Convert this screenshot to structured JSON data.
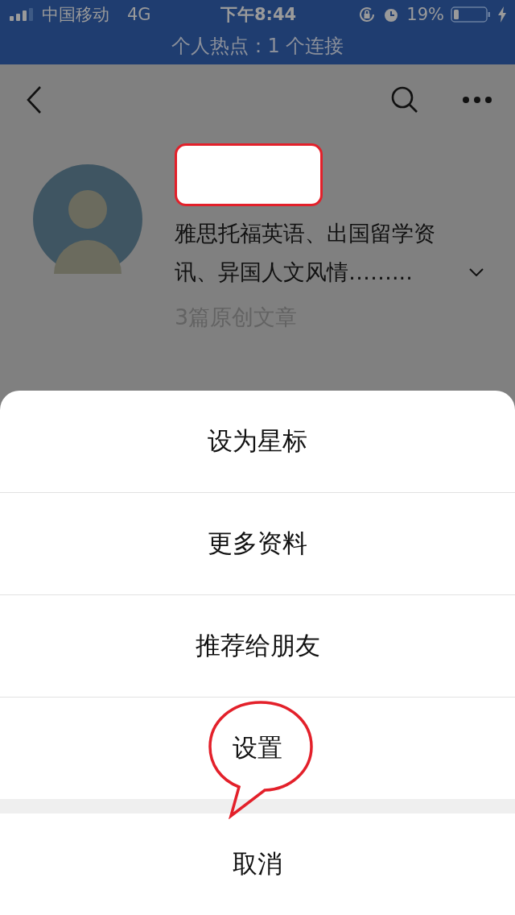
{
  "status_bar": {
    "carrier": "中国移动",
    "network": "4G",
    "time": "下午8:44",
    "battery": "19%"
  },
  "hotspot_banner": "个人热点：1 个连接",
  "profile": {
    "description": "雅思托福英语、出国留学资讯、异国人文风情……...",
    "articles": "3篇原创文章"
  },
  "action_sheet": {
    "items": [
      {
        "label": "设为星标"
      },
      {
        "label": "更多资料"
      },
      {
        "label": "推荐给朋友"
      },
      {
        "label": "设置",
        "highlighted": true
      }
    ],
    "cancel": "取消"
  }
}
